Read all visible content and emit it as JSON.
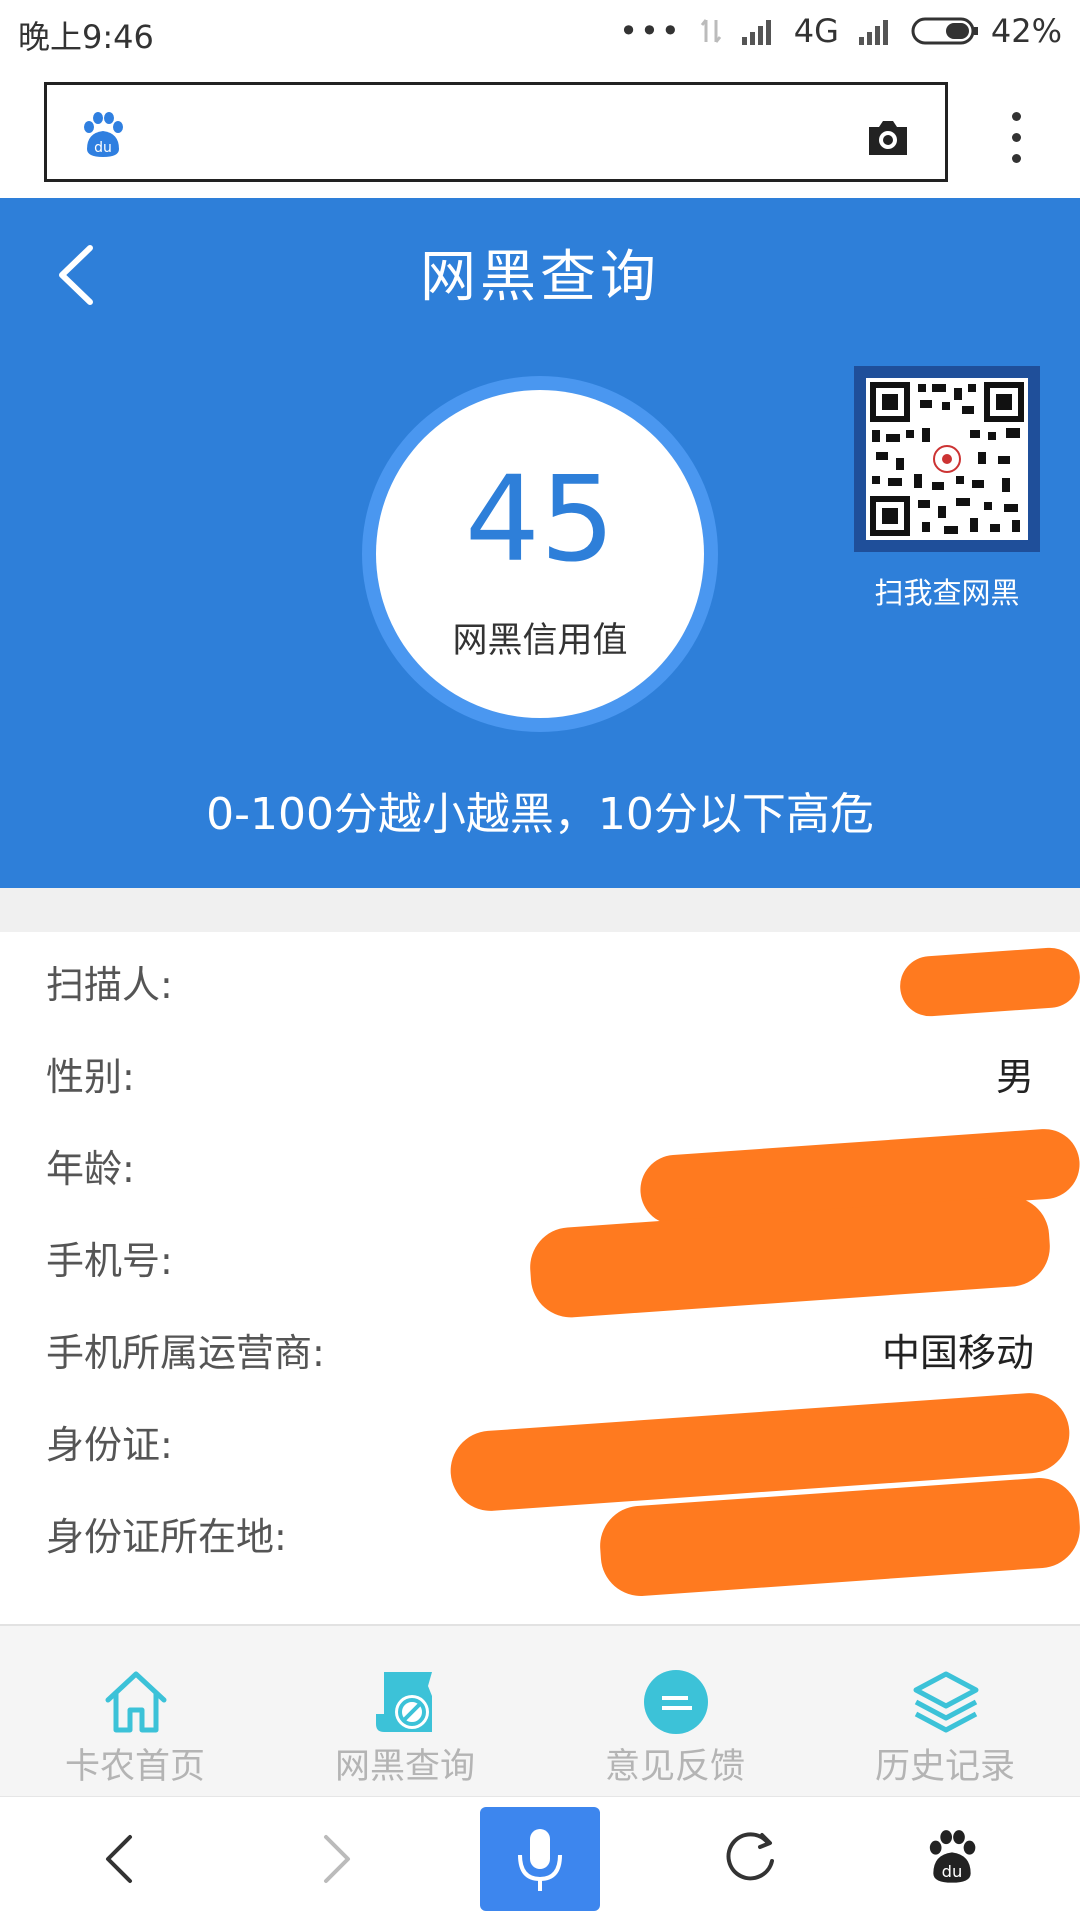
{
  "status_bar": {
    "time": "晚上9:46",
    "network": "4G",
    "battery": "42%"
  },
  "browser": {
    "search_placeholder": "",
    "camera_icon": "camera-icon",
    "menu_icon": "more-vertical-icon"
  },
  "header": {
    "title": "网黑查询",
    "back_icon": "chevron-left-icon"
  },
  "score": {
    "value": "45",
    "label": "网黑信用值",
    "accent": "#2e7fd9"
  },
  "qr": {
    "caption": "扫我查网黑"
  },
  "hero_note": "0-100分越小越黑，10分以下高危",
  "info_rows": [
    {
      "label": "扫描人:",
      "value": ""
    },
    {
      "label": "性别:",
      "value": "男"
    },
    {
      "label": "年龄:",
      "value": ""
    },
    {
      "label": "手机号:",
      "value": ""
    },
    {
      "label": "手机所属运营商:",
      "value": "中国移动"
    },
    {
      "label": "身份证:",
      "value": ""
    },
    {
      "label": "身份证所在地:",
      "value": ""
    }
  ],
  "tabs": [
    {
      "label": "卡农首页",
      "icon": "home-icon"
    },
    {
      "label": "网黑查询",
      "icon": "blacklist-query-icon"
    },
    {
      "label": "意见反馈",
      "icon": "feedback-icon"
    },
    {
      "label": "历史记录",
      "icon": "layers-icon"
    }
  ],
  "nav": {
    "icons": [
      "back-arrow-icon",
      "forward-arrow-icon",
      "microphone-icon",
      "refresh-icon",
      "baidu-paw-icon"
    ]
  },
  "colors": {
    "hero_blue": "#2e7fd9",
    "tab_teal": "#3cc2d8",
    "redaction": "#ff7a1f",
    "mic_blue": "#3d86ee"
  }
}
